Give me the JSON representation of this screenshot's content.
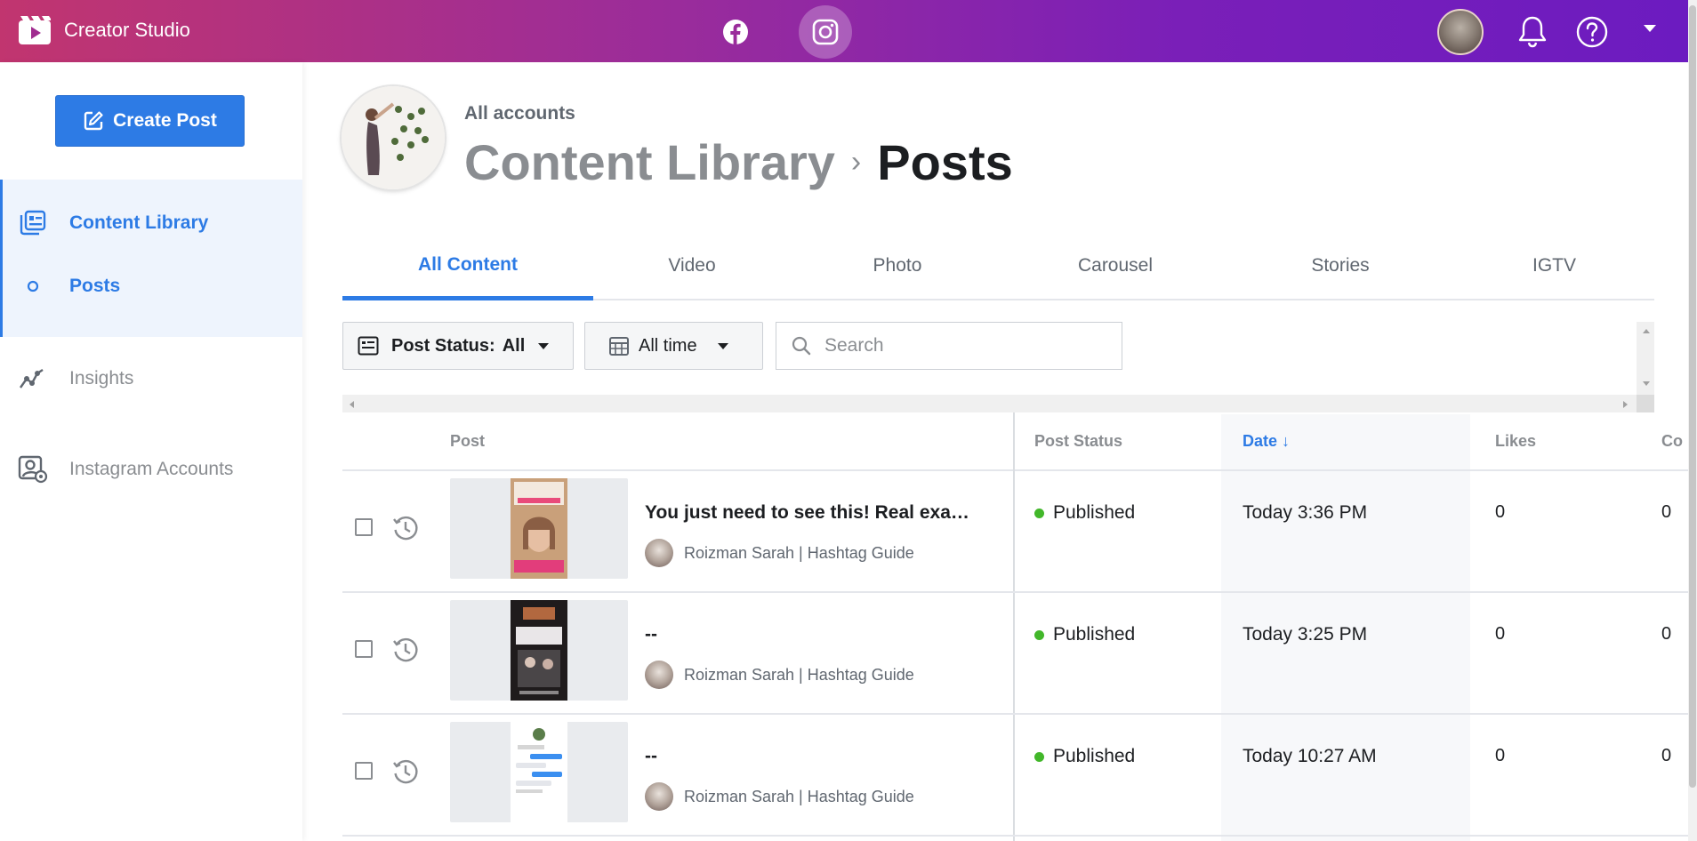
{
  "app": {
    "title": "Creator Studio",
    "platforms": [
      {
        "name": "facebook-icon",
        "active": false
      },
      {
        "name": "instagram-icon",
        "active": true
      }
    ],
    "top_icons": [
      "bell-icon",
      "help-icon",
      "caret-down-icon"
    ]
  },
  "sidebar": {
    "create_label": "Create Post",
    "items": [
      {
        "label": "Content Library",
        "icon": "content-library-icon",
        "active": true
      },
      {
        "label": "Posts",
        "icon": "circle-icon",
        "active": true
      },
      {
        "label": "Insights",
        "icon": "insights-icon",
        "active": false
      },
      {
        "label": "Instagram Accounts",
        "icon": "accounts-icon",
        "active": false
      }
    ]
  },
  "header": {
    "account": "All accounts",
    "breadcrumb_parent": "Content Library",
    "breadcrumb_sep": "›",
    "breadcrumb_current": "Posts"
  },
  "tabs": [
    "All Content",
    "Video",
    "Photo",
    "Carousel",
    "Stories",
    "IGTV"
  ],
  "filters": {
    "status_label": "Post Status:",
    "status_value": "All",
    "time_value": "All time",
    "search_placeholder": "Search"
  },
  "table": {
    "columns": [
      "Post",
      "Post Status",
      "Date ↓",
      "Likes",
      "Co"
    ],
    "rows": [
      {
        "title": "You just need to see this! Real exa…",
        "author": "Roizman Sarah | Hashtag Guide",
        "status": "Published",
        "date": "Today 3:36 PM",
        "likes": "0",
        "comments": "0"
      },
      {
        "title": "--",
        "author": "Roizman Sarah | Hashtag Guide",
        "status": "Published",
        "date": "Today 3:25 PM",
        "likes": "0",
        "comments": "0"
      },
      {
        "title": "--",
        "author": "Roizman Sarah | Hashtag Guide",
        "status": "Published",
        "date": "Today 10:27 AM",
        "likes": "0",
        "comments": "0"
      }
    ]
  },
  "colors": {
    "accent": "#2d7be5",
    "published": "#42b72a",
    "topbar_start": "#c1356f",
    "topbar_end": "#6c1bc0"
  }
}
